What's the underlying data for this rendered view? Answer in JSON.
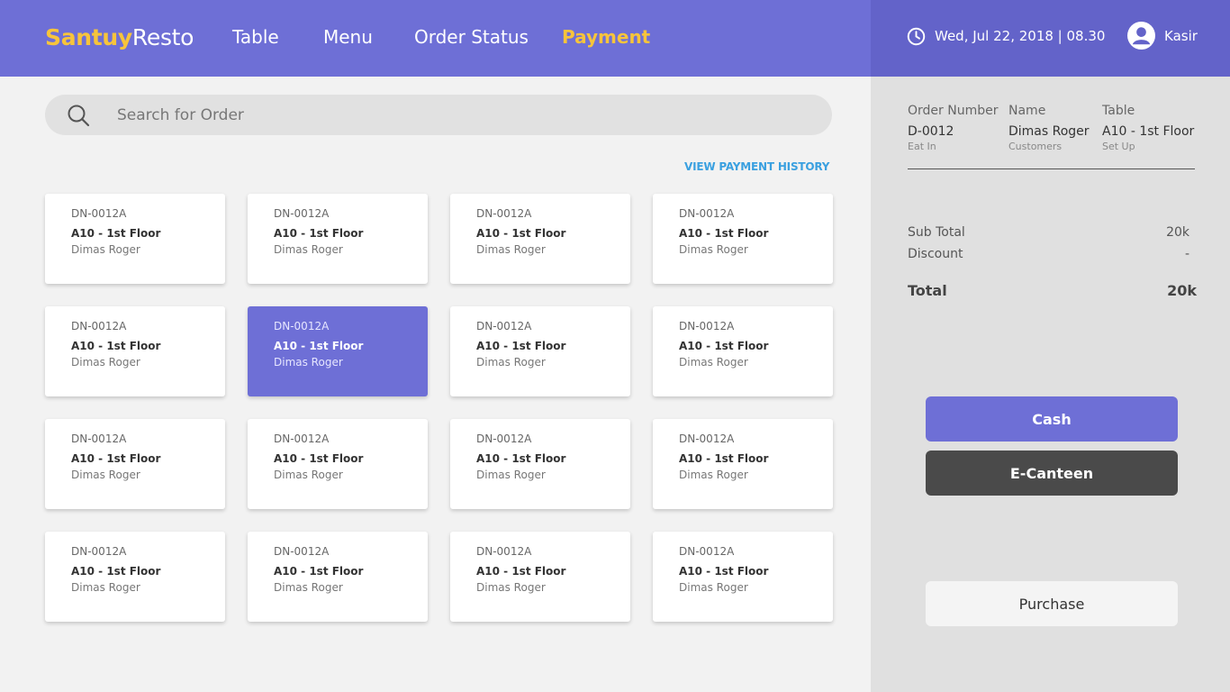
{
  "header": {
    "brand_bold": "Santuy",
    "brand_light": "Resto",
    "nav": [
      {
        "label": "Table"
      },
      {
        "label": "Menu"
      },
      {
        "label": "Order Status"
      },
      {
        "label": "Payment",
        "active": true
      }
    ],
    "datetime": "Wed, Jul 22, 2018 | 08.30",
    "user": "Kasir"
  },
  "search": {
    "placeholder": "Search for Order",
    "value": ""
  },
  "view_history_label": "VIEW PAYMENT HISTORY",
  "orders": [
    {
      "id": "DN-0012A",
      "table": "A10 - 1st Floor",
      "name": "Dimas Roger",
      "selected": false
    },
    {
      "id": "DN-0012A",
      "table": "A10 - 1st Floor",
      "name": "Dimas Roger",
      "selected": false
    },
    {
      "id": "DN-0012A",
      "table": "A10 - 1st Floor",
      "name": "Dimas Roger",
      "selected": false
    },
    {
      "id": "DN-0012A",
      "table": "A10 - 1st Floor",
      "name": "Dimas Roger",
      "selected": false
    },
    {
      "id": "DN-0012A",
      "table": "A10 - 1st Floor",
      "name": "Dimas Roger",
      "selected": false
    },
    {
      "id": "DN-0012A",
      "table": "A10 - 1st Floor",
      "name": "Dimas Roger",
      "selected": true
    },
    {
      "id": "DN-0012A",
      "table": "A10 - 1st Floor",
      "name": "Dimas Roger",
      "selected": false
    },
    {
      "id": "DN-0012A",
      "table": "A10 - 1st Floor",
      "name": "Dimas Roger",
      "selected": false
    },
    {
      "id": "DN-0012A",
      "table": "A10 - 1st Floor",
      "name": "Dimas Roger",
      "selected": false
    },
    {
      "id": "DN-0012A",
      "table": "A10 - 1st Floor",
      "name": "Dimas Roger",
      "selected": false
    },
    {
      "id": "DN-0012A",
      "table": "A10 - 1st Floor",
      "name": "Dimas Roger",
      "selected": false
    },
    {
      "id": "DN-0012A",
      "table": "A10 - 1st Floor",
      "name": "Dimas Roger",
      "selected": false
    },
    {
      "id": "DN-0012A",
      "table": "A10 - 1st Floor",
      "name": "Dimas Roger",
      "selected": false
    },
    {
      "id": "DN-0012A",
      "table": "A10 - 1st Floor",
      "name": "Dimas Roger",
      "selected": false
    },
    {
      "id": "DN-0012A",
      "table": "A10 - 1st Floor",
      "name": "Dimas Roger",
      "selected": false
    },
    {
      "id": "DN-0012A",
      "table": "A10 - 1st Floor",
      "name": "Dimas Roger",
      "selected": false
    }
  ],
  "order_detail": {
    "order_number": {
      "header": "Order Number",
      "value": "D-0012",
      "sub": "Eat In"
    },
    "name": {
      "header": "Name",
      "value": "Dimas Roger",
      "sub": "Customers"
    },
    "table": {
      "header": "Table",
      "value": "A10 - 1st Floor",
      "sub": "Set Up"
    }
  },
  "summary": {
    "subtotal_label": "Sub Total",
    "subtotal_value": "20k",
    "discount_label": "Discount",
    "discount_value": "-",
    "total_label": "Total",
    "total_value": "20k"
  },
  "buttons": {
    "cash": "Cash",
    "ecanteen": "E-Canteen",
    "purchase": "Purchase"
  },
  "colors": {
    "primary": "#6e6fd6",
    "primary_dark": "#6363c9",
    "accent_yellow": "#f7c43b",
    "link_blue": "#3aa0e0",
    "dark_button": "#4a4a4a"
  },
  "icons": {
    "clock": "clock-icon",
    "user": "user-avatar-icon",
    "search": "search-icon"
  }
}
